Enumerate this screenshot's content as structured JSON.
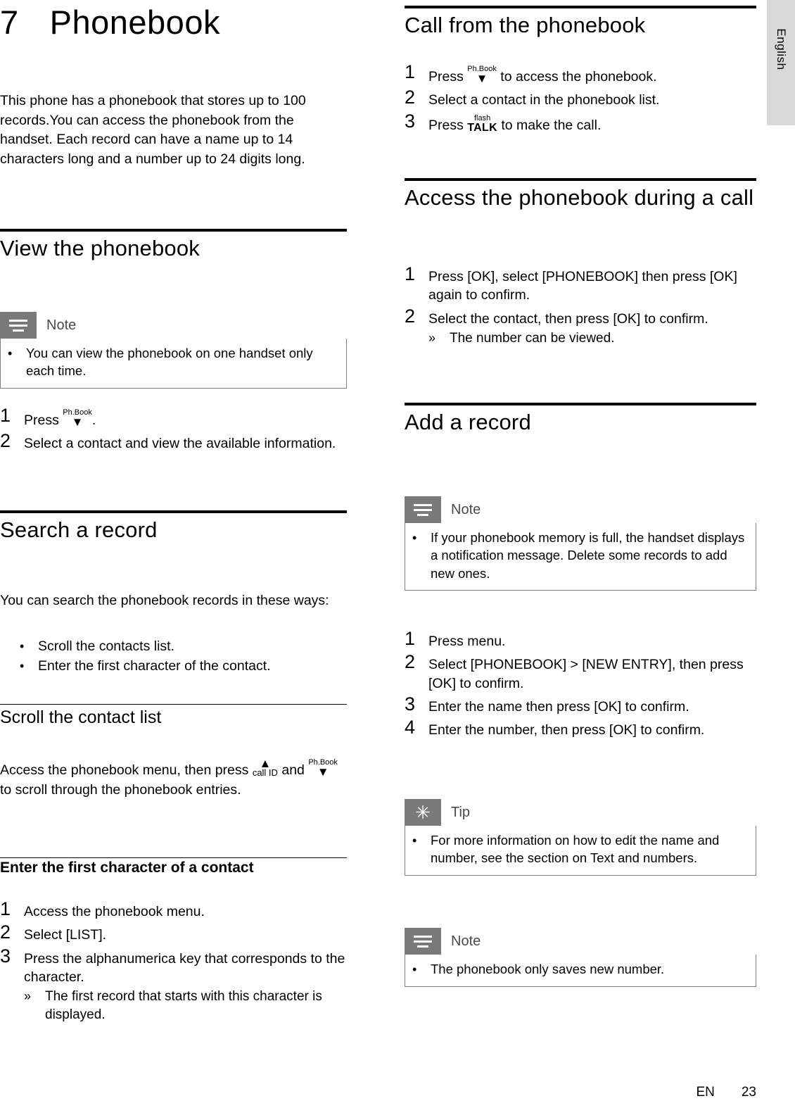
{
  "edge_tab": {
    "label": "English"
  },
  "left": {
    "chapter_number": "7",
    "chapter_title": "Phonebook",
    "intro": "This phone has a phonebook that stores up to 100 records.You can access the phonebook from the handset. Each record can have a name up to 14 characters long and a number up to 24 digits long.",
    "view": {
      "heading": "View the phonebook",
      "note": {
        "label": "Note",
        "bullets": [
          "You can view the phonebook on one handset only each time."
        ]
      },
      "steps": [
        {
          "num": "1",
          "text_before": "Press",
          "key": "Ph.Book",
          "text_after": "."
        },
        {
          "num": "2",
          "text": "Select a contact and view the available information."
        }
      ]
    },
    "search": {
      "heading": "Search a record",
      "intro": "You can search the phonebook records in these ways:",
      "bullets": [
        "Scroll the contacts list.",
        "Enter the first character of the contact."
      ]
    },
    "scroll": {
      "heading": "Scroll the contact list",
      "text_1": "Access the phonebook menu, then press",
      "key_1": "call ID",
      "text_2": "and",
      "key_2": "Ph.Book",
      "text_3": "to scroll through the phonebook entries."
    },
    "first_char": {
      "heading": "Enter the first character of a contact",
      "steps": [
        {
          "num": "1",
          "text": "Access the phonebook menu."
        },
        {
          "num": "2",
          "text": "Select [LIST]."
        },
        {
          "num": "3",
          "text": "Press the alphanumerica key that corresponds to the character.",
          "substep": "The first record that starts with this character is displayed."
        }
      ]
    }
  },
  "right": {
    "call_from": {
      "heading": "Call from the phonebook",
      "steps": [
        {
          "num": "1",
          "text_before": "Press",
          "key": "Ph.Book",
          "text_after": "to access the phonebook."
        },
        {
          "num": "2",
          "text": "Select a contact in the phonebook list."
        },
        {
          "num": "3",
          "text_before": "Press",
          "key_cap": "flash",
          "key_glyph": "TALK",
          "text_after": "to make the call."
        }
      ]
    },
    "access_during": {
      "heading": "Access the phonebook during a call",
      "steps": [
        {
          "num": "1",
          "text": "Press [OK], select [PHONEBOOK] then press [OK] again to confirm."
        },
        {
          "num": "2",
          "text": "Select the contact, then press [OK] to confirm.",
          "substep": "The number can be viewed."
        }
      ]
    },
    "add_record": {
      "heading": "Add a record",
      "note": {
        "label": "Note",
        "bullets": [
          "If your phonebook memory is full, the handset displays a notification message. Delete some records to add new ones."
        ]
      },
      "steps": [
        {
          "num": "1",
          "text": "Press menu."
        },
        {
          "num": "2",
          "text": "Select [PHONEBOOK] > [NEW ENTRY], then press [OK] to confirm."
        },
        {
          "num": "3",
          "text": "Enter the name then press [OK] to confirm."
        },
        {
          "num": "4",
          "text": "Enter the number, then press [OK] to confirm."
        }
      ],
      "tip": {
        "label": "Tip",
        "bullets": [
          "For more information on how to edit the name and number, see the section on Text and numbers."
        ]
      },
      "note2": {
        "label": "Note",
        "bullets": [
          "The phonebook only saves new number."
        ]
      }
    }
  },
  "footer": {
    "lang": "EN",
    "page": "23"
  }
}
